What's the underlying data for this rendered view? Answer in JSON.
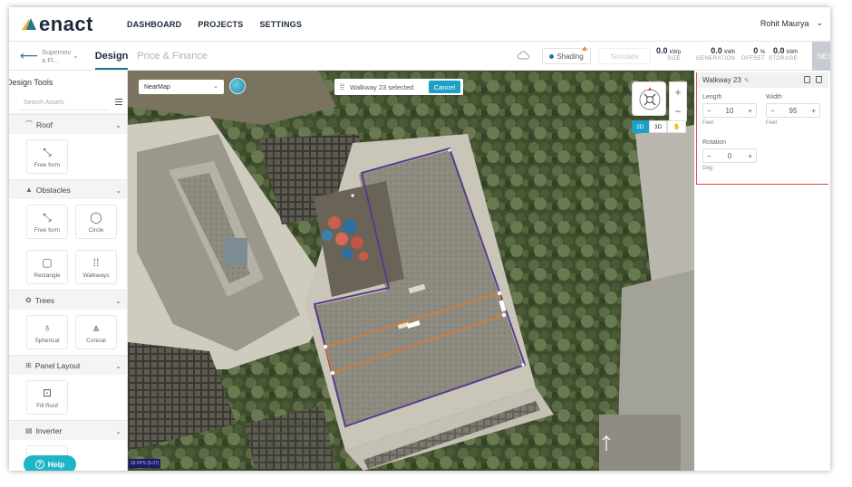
{
  "app": {
    "logo_text": "enact",
    "nav": [
      "DASHBOARD",
      "PROJECTS",
      "SETTINGS"
    ],
    "user": "Rohit Maurya",
    "brand_colors": {
      "primary": "#1d7a8c",
      "accent": "#1d9fc7",
      "orange": "#f2a93b",
      "highlight": "#e04848"
    }
  },
  "project": {
    "name": "Supernov a Fl...",
    "tabs": {
      "active": "Design",
      "inactive": "Price & Finance"
    },
    "shading_label": "Shading",
    "simulate_label": "Simulate",
    "metrics": [
      {
        "value": "0.0",
        "unit": "kWp",
        "label": "SIZE"
      },
      {
        "value": "0.0",
        "unit": "kWh",
        "label": "GENERATION"
      },
      {
        "value": "0",
        "unit": "%",
        "label": "OFFSET"
      },
      {
        "value": "0.0",
        "unit": "kWh",
        "label": "STORAGE"
      }
    ],
    "next_label": "NEXT"
  },
  "sidebar": {
    "title": "Design Tools",
    "search_placeholder": "Search Assets",
    "sections": [
      {
        "name": "Roof",
        "icon": "roof-icon",
        "glyph": "⌒",
        "tools": [
          {
            "label": "Free form",
            "icon": "freeform-icon",
            "glyph": "⤡"
          }
        ]
      },
      {
        "name": "Obstacles",
        "icon": "obstacle-icon",
        "glyph": "▲",
        "tools": [
          {
            "label": "Free form",
            "icon": "freeform-icon",
            "glyph": "⤡"
          },
          {
            "label": "Circle",
            "icon": "circle-icon",
            "glyph": "◯"
          },
          {
            "label": "Rectangle",
            "icon": "rectangle-icon",
            "glyph": "▢"
          },
          {
            "label": "Walkways",
            "icon": "walkway-icon",
            "glyph": "⁞⁞"
          }
        ]
      },
      {
        "name": "Trees",
        "icon": "tree-icon",
        "glyph": "✿",
        "tools": [
          {
            "label": "Spherical",
            "icon": "spherical-tree-icon",
            "glyph": "♁"
          },
          {
            "label": "Conical",
            "icon": "conical-tree-icon",
            "glyph": "⩓"
          }
        ]
      },
      {
        "name": "Panel Layout",
        "icon": "panel-icon",
        "glyph": "⊞",
        "tools": [
          {
            "label": "Fill Roof",
            "icon": "fill-roof-icon",
            "glyph": "⊡"
          }
        ]
      },
      {
        "name": "Inverter",
        "icon": "inverter-icon",
        "glyph": "▤",
        "tools": [
          {
            "label": "",
            "icon": "inverter-tool-icon",
            "glyph": "▣"
          }
        ]
      }
    ],
    "help_label": "Help"
  },
  "map": {
    "provider": "NearMap",
    "selection_text": "Walkway 23 selected",
    "cancel_label": "Cancel",
    "view_modes": [
      "2D",
      "3D"
    ],
    "active_view": "2D",
    "fps_text": "33 FPS (0-37)"
  },
  "properties": {
    "title": "Walkway 23",
    "length": {
      "label": "Length",
      "value": "10",
      "unit": "Feet"
    },
    "width": {
      "label": "Width",
      "value": "95",
      "unit": "Feet"
    },
    "rotation": {
      "label": "Rotation",
      "value": "0",
      "unit": "Deg"
    }
  }
}
